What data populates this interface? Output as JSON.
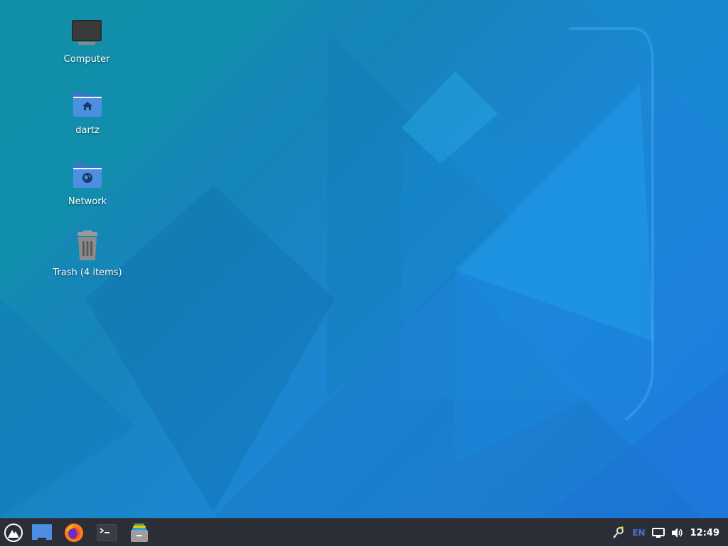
{
  "desktop": {
    "icons": [
      {
        "label": "Computer",
        "icon": "computer-icon"
      },
      {
        "label": "dartz",
        "icon": "home-folder-icon"
      },
      {
        "label": "Network",
        "icon": "network-folder-icon"
      },
      {
        "label": "Trash (4 items)",
        "icon": "trash-icon"
      }
    ]
  },
  "taskbar": {
    "launchers": [
      {
        "name": "app-menu",
        "icon": "manjaro-logo-icon"
      },
      {
        "name": "show-desktop",
        "icon": "desktop-icon"
      },
      {
        "name": "firefox",
        "icon": "firefox-icon"
      },
      {
        "name": "terminal",
        "icon": "terminal-icon"
      },
      {
        "name": "file-manager",
        "icon": "file-manager-icon"
      }
    ],
    "tray": {
      "network_icon": "network-key-icon",
      "keyboard_layout": "EN",
      "display_icon": "display-icon",
      "volume_icon": "volume-icon",
      "clock": "12:49"
    }
  },
  "colors": {
    "taskbar_bg": "#2b2e37",
    "folder_blue": "#4d8fe0",
    "accent_layout": "#4a6fd1"
  }
}
